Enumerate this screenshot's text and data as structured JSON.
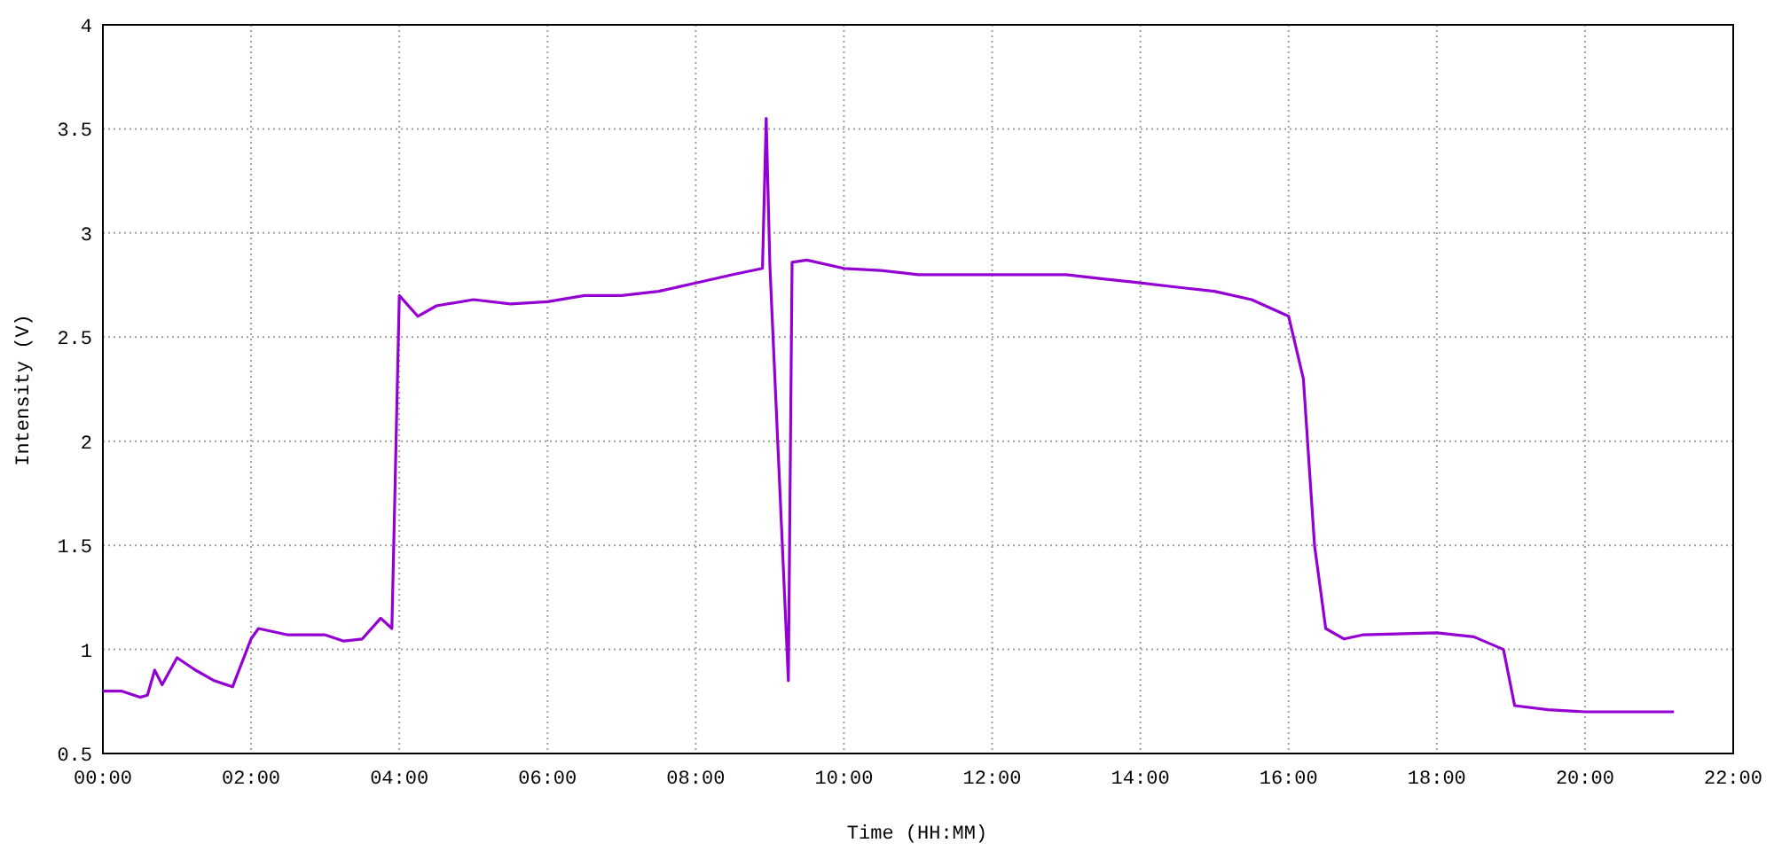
{
  "chart_data": {
    "type": "line",
    "xlabel": "Time (HH:MM)",
    "ylabel": "Intensity (V)",
    "grid": true,
    "xlim": [
      0,
      22
    ],
    "ylim": [
      0.5,
      4
    ],
    "xticks": [
      {
        "value": 0,
        "label": "00:00"
      },
      {
        "value": 2,
        "label": "02:00"
      },
      {
        "value": 4,
        "label": "04:00"
      },
      {
        "value": 6,
        "label": "06:00"
      },
      {
        "value": 8,
        "label": "08:00"
      },
      {
        "value": 10,
        "label": "10:00"
      },
      {
        "value": 12,
        "label": "12:00"
      },
      {
        "value": 14,
        "label": "14:00"
      },
      {
        "value": 16,
        "label": "16:00"
      },
      {
        "value": 18,
        "label": "18:00"
      },
      {
        "value": 20,
        "label": "20:00"
      },
      {
        "value": 22,
        "label": "22:00"
      }
    ],
    "yticks": [
      0.5,
      1,
      1.5,
      2,
      2.5,
      3,
      3.5,
      4
    ],
    "x": [
      0,
      0.25,
      0.5,
      0.6,
      0.7,
      0.8,
      1.0,
      1.25,
      1.5,
      1.75,
      2.0,
      2.1,
      2.5,
      3.0,
      3.25,
      3.5,
      3.75,
      3.9,
      4.0,
      4.25,
      4.5,
      5,
      5.5,
      6,
      6.5,
      7,
      7.5,
      8,
      8.5,
      8.9,
      8.95,
      9.0,
      9.25,
      9.3,
      9.5,
      10,
      10.5,
      11,
      11.5,
      12,
      12.5,
      13,
      13.5,
      14,
      14.5,
      15,
      15.5,
      16,
      16.2,
      16.35,
      16.5,
      16.75,
      17,
      18,
      18.5,
      18.9,
      19.05,
      19.5,
      20,
      20.5,
      21,
      21.2
    ],
    "series": [
      {
        "color": "#9400d3",
        "values": [
          0.8,
          0.8,
          0.77,
          0.78,
          0.9,
          0.83,
          0.96,
          0.9,
          0.85,
          0.82,
          1.05,
          1.1,
          1.07,
          1.07,
          1.04,
          1.05,
          1.15,
          1.1,
          2.7,
          2.6,
          2.65,
          2.68,
          2.66,
          2.67,
          2.7,
          2.7,
          2.72,
          2.76,
          2.8,
          2.83,
          3.55,
          2.84,
          0.85,
          2.86,
          2.87,
          2.83,
          2.82,
          2.8,
          2.8,
          2.8,
          2.8,
          2.8,
          2.78,
          2.76,
          2.74,
          2.72,
          2.68,
          2.6,
          2.3,
          1.5,
          1.1,
          1.05,
          1.07,
          1.08,
          1.06,
          1.0,
          0.73,
          0.71,
          0.7,
          0.7,
          0.7,
          0.7
        ]
      }
    ]
  }
}
